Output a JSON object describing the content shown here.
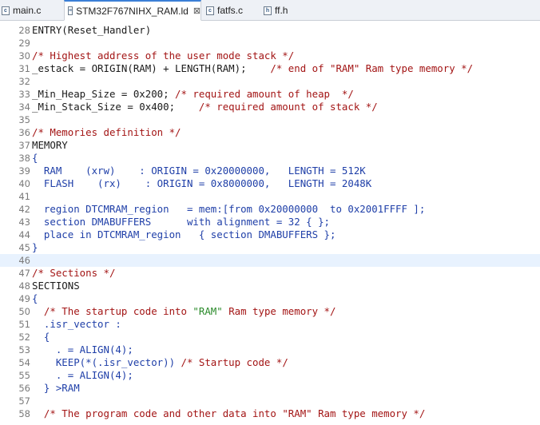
{
  "tabs": [
    {
      "label": "main.c",
      "icon": "c-file-icon",
      "active": false
    },
    {
      "label": "STM32F767NIHX_RAM.ld",
      "icon": "linker-file-icon",
      "active": true,
      "close": "⊠"
    },
    {
      "label": "fatfs.c",
      "icon": "c-file-icon",
      "active": false
    },
    {
      "label": "ff.h",
      "icon": "h-file-icon",
      "active": false
    }
  ],
  "colors": {
    "comment": "#a31515",
    "blue": "#1f3fa8",
    "string": "#2a8a2a",
    "highlight": "#e8f2fe"
  },
  "lines": [
    {
      "n": "28",
      "t": "ENTRY(Reset_Handler)"
    },
    {
      "n": "29",
      "t": ""
    },
    {
      "n": "30",
      "c": "/* Highest address of the user mode stack */"
    },
    {
      "n": "31",
      "t": "_estack = ORIGIN(RAM) + LENGTH(RAM);    ",
      "c": "/* end of \"RAM\" Ram type memory */"
    },
    {
      "n": "32",
      "t": ""
    },
    {
      "n": "33",
      "t": "_Min_Heap_Size = 0x200; ",
      "c": "/* required amount of heap  */"
    },
    {
      "n": "34",
      "t": "_Min_Stack_Size = 0x400;    ",
      "c": "/* required amount of stack */"
    },
    {
      "n": "35",
      "t": ""
    },
    {
      "n": "36",
      "c": "/* Memories definition */"
    },
    {
      "n": "37",
      "t": "MEMORY"
    },
    {
      "n": "38",
      "b": "{"
    },
    {
      "n": "39",
      "b": "  RAM    (xrw)    : ORIGIN = 0x20000000,   LENGTH = 512K"
    },
    {
      "n": "40",
      "b": "  FLASH    (rx)    : ORIGIN = 0x8000000,   LENGTH = 2048K"
    },
    {
      "n": "41",
      "t": ""
    },
    {
      "n": "42",
      "b": "  region DTCMRAM_region   = mem:[from 0x20000000  to 0x2001FFFF ];"
    },
    {
      "n": "43",
      "b": "  section DMABUFFERS      with alignment = 32 { };"
    },
    {
      "n": "44",
      "b": "  place in DTCMRAM_region   { section DMABUFFERS };"
    },
    {
      "n": "45",
      "b": "}"
    },
    {
      "n": "46",
      "t": "",
      "hl": true
    },
    {
      "n": "47",
      "c": "/* Sections */"
    },
    {
      "n": "48",
      "t": "SECTIONS"
    },
    {
      "n": "49",
      "b": "{"
    },
    {
      "n": "50",
      "seg": [
        [
          "b",
          "  "
        ],
        [
          "c",
          "/* The startup code into "
        ],
        [
          "s",
          "\"RAM\""
        ],
        [
          "c",
          " Ram type memory */"
        ]
      ]
    },
    {
      "n": "51",
      "b": "  .isr_vector :"
    },
    {
      "n": "52",
      "b": "  {"
    },
    {
      "n": "53",
      "b": "    . = ALIGN(4);"
    },
    {
      "n": "54",
      "seg": [
        [
          "b",
          "    KEEP(*(.isr_vector)) "
        ],
        [
          "c",
          "/* Startup code */"
        ]
      ]
    },
    {
      "n": "55",
      "b": "    . = ALIGN(4);"
    },
    {
      "n": "56",
      "b": "  } >RAM"
    },
    {
      "n": "57",
      "t": ""
    },
    {
      "n": "58",
      "seg": [
        [
          "b",
          "  "
        ],
        [
          "c",
          "/* The program code and other data into \"RAM\" Ram type memory */"
        ]
      ]
    }
  ]
}
